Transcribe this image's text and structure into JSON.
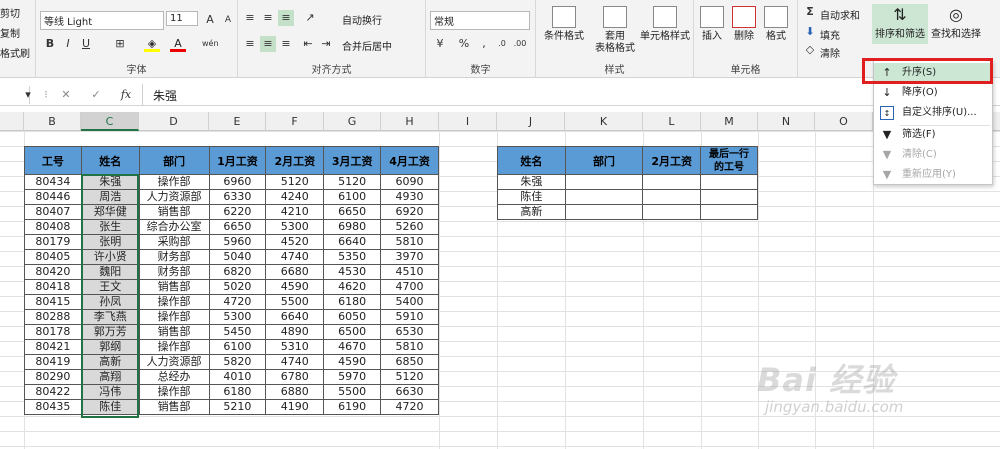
{
  "clipboard": {
    "cut": "剪切",
    "copy": "复制",
    "painter": "格式刷"
  },
  "font": {
    "name": "等线 Light",
    "size": "11",
    "label": "字体",
    "bold": "B",
    "italic": "I",
    "underline": "U",
    "wen": "wén"
  },
  "align": {
    "wrap": "自动换行",
    "merge": "合并后居中",
    "label": "对齐方式"
  },
  "number": {
    "format": "常规",
    "label": "数字"
  },
  "styles": {
    "cond": "条件格式",
    "table1": "套用",
    "table2": "表格格式",
    "cell": "单元格样式",
    "label": "样式"
  },
  "cells": {
    "insert": "插入",
    "delete": "删除",
    "format": "格式",
    "label": "单元格"
  },
  "editing": {
    "autosum": "自动求和",
    "fill": "填充",
    "clear": "清除",
    "sort": "排序和筛选",
    "find": "查找和选择"
  },
  "formula": {
    "namebox": "",
    "value": "朱强",
    "fx": "fx"
  },
  "columns": [
    "B",
    "C",
    "D",
    "E",
    "F",
    "G",
    "H",
    "I",
    "J",
    "K",
    "L",
    "M",
    "N",
    "O"
  ],
  "table1": {
    "headers": [
      "工号",
      "姓名",
      "部门",
      "1月工资",
      "2月工资",
      "3月工资",
      "4月工资"
    ],
    "rows": [
      [
        "80434",
        "朱强",
        "操作部",
        "6960",
        "5120",
        "5120",
        "6090"
      ],
      [
        "80446",
        "周浩",
        "人力资源部",
        "6330",
        "4240",
        "6100",
        "4930"
      ],
      [
        "80407",
        "郑华健",
        "销售部",
        "6220",
        "4210",
        "6650",
        "6920"
      ],
      [
        "80408",
        "张生",
        "综合办公室",
        "6650",
        "5300",
        "6980",
        "5260"
      ],
      [
        "80179",
        "张明",
        "采购部",
        "5960",
        "4520",
        "6640",
        "5810"
      ],
      [
        "80405",
        "许小贤",
        "财务部",
        "5040",
        "4740",
        "5350",
        "3970"
      ],
      [
        "80420",
        "魏阳",
        "财务部",
        "6820",
        "6680",
        "4530",
        "4510"
      ],
      [
        "80418",
        "王文",
        "销售部",
        "5020",
        "4590",
        "4620",
        "4700"
      ],
      [
        "80415",
        "孙凤",
        "操作部",
        "4720",
        "5500",
        "6180",
        "5400"
      ],
      [
        "80288",
        "李飞燕",
        "操作部",
        "5300",
        "6640",
        "6050",
        "5910"
      ],
      [
        "80178",
        "郭万芳",
        "销售部",
        "5450",
        "4890",
        "6500",
        "6530"
      ],
      [
        "80421",
        "郭纲",
        "操作部",
        "6100",
        "5310",
        "4670",
        "5810"
      ],
      [
        "80419",
        "高新",
        "人力资源部",
        "5820",
        "4740",
        "4590",
        "6850"
      ],
      [
        "80290",
        "高翔",
        "总经办",
        "4010",
        "6780",
        "5970",
        "5120"
      ],
      [
        "80422",
        "冯伟",
        "操作部",
        "6180",
        "6880",
        "5500",
        "6630"
      ],
      [
        "80435",
        "陈佳",
        "销售部",
        "5210",
        "4190",
        "6190",
        "4720"
      ]
    ]
  },
  "table2": {
    "headers": [
      "姓名",
      "部门",
      "2月工资",
      "最后一行",
      "的工号"
    ],
    "rows": [
      [
        "朱强",
        "",
        "",
        ""
      ],
      [
        "陈佳",
        "",
        "",
        ""
      ],
      [
        "高新",
        "",
        "",
        ""
      ]
    ]
  },
  "menu": {
    "items": [
      {
        "label": "升序(S)",
        "icon": "sort-ascending-icon"
      },
      {
        "label": "降序(O)",
        "icon": "sort-descending-icon"
      },
      {
        "label": "自定义排序(U)...",
        "icon": "custom-sort-icon"
      },
      {
        "label": "筛选(F)",
        "icon": "filter-icon"
      },
      {
        "label": "清除(C)",
        "icon": "clear-filter-icon"
      },
      {
        "label": "重新应用(Y)",
        "icon": "reapply-icon"
      }
    ]
  },
  "watermark": {
    "logo": "Bai 经验",
    "url": "jingyan.baidu.com"
  }
}
